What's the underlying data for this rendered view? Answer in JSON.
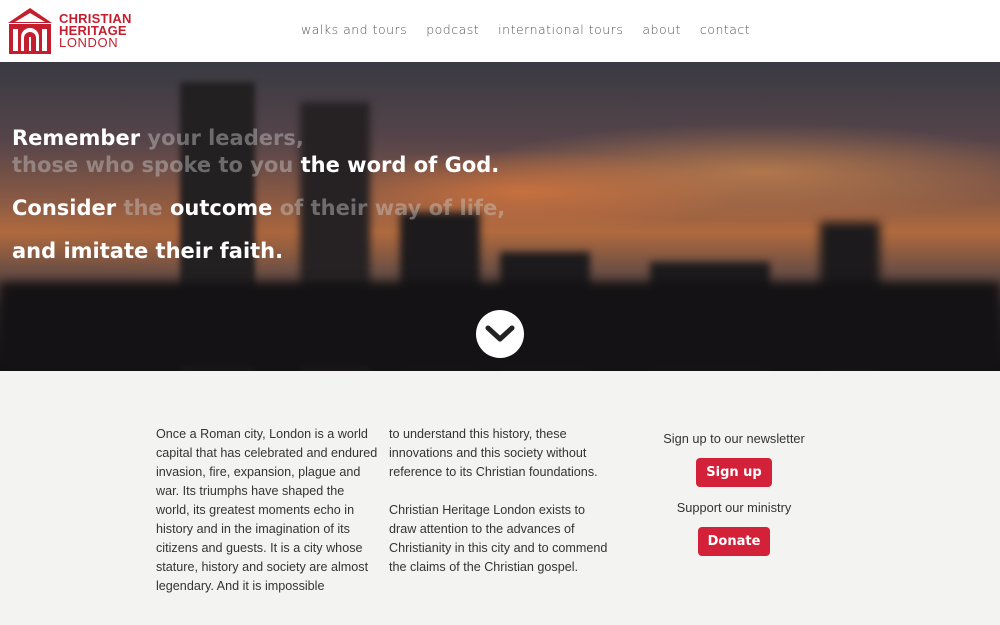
{
  "brand": {
    "line1": "CHRISTIAN",
    "line2": "HERITAGE",
    "line3": "LONDON",
    "color": "#c41e2e"
  },
  "nav": {
    "items": [
      "walks and tours",
      "podcast",
      "international tours",
      "about",
      "contact"
    ]
  },
  "hero": {
    "line1": {
      "a": "Remember ",
      "b": "your leaders,"
    },
    "line2": {
      "a": "those who spoke to you ",
      "b": "the word of God."
    },
    "line3": {
      "a": "Consider ",
      "b": "the ",
      "c": "outcome ",
      "d": "of their way of life,"
    },
    "line4": "and imitate their faith.",
    "scroll_icon": "chevron-down-icon"
  },
  "intro": {
    "col1": "Once a Roman city, London is a world capital that has celebrated and endured invasion, fire, expansion, plague and war. Its triumphs have shaped the world, its greatest moments echo in history and in the imagination of its citizens and guests. It is a city whose stature, history and society are almost legendary. And it is impossible",
    "col2_p1": "to understand this history, these innovations and this society without reference to its Christian foundations.",
    "col2_p2": "Christian Heritage London exists to draw attention to the advances of Christianity in this city and to commend the claims of the Christian gospel."
  },
  "sidebar": {
    "newsletter_label": "Sign up to our newsletter",
    "signup_button": "Sign up",
    "ministry_label": "Support our ministry",
    "donate_button": "Donate",
    "button_color": "#d3213a"
  }
}
